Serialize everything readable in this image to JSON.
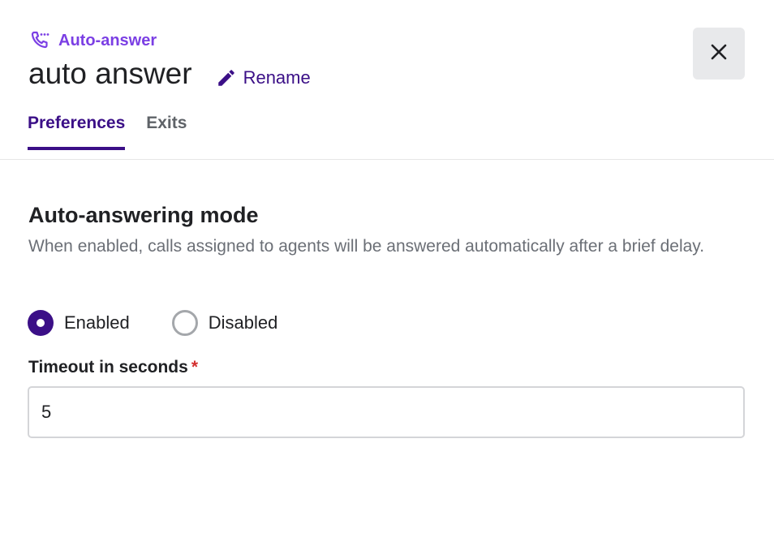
{
  "header": {
    "type_label": "Auto-answer",
    "type_icon": "phone-auto-answer-icon",
    "title": "auto answer",
    "rename_label": "Rename",
    "rename_icon": "pencil-icon",
    "close_icon": "close-icon"
  },
  "tabs": [
    {
      "label": "Preferences",
      "active": true
    },
    {
      "label": "Exits",
      "active": false
    }
  ],
  "section": {
    "title": "Auto-answering mode",
    "description": "When enabled, calls assigned to agents will be answered automatically after a brief delay."
  },
  "mode_options": [
    {
      "label": "Enabled",
      "selected": true
    },
    {
      "label": "Disabled",
      "selected": false
    }
  ],
  "timeout": {
    "label": "Timeout in seconds",
    "required_mark": "*",
    "value": "5"
  },
  "colors": {
    "accent": "#3b0f87",
    "type_label": "#7b3fe4",
    "required": "#d32f2f"
  }
}
